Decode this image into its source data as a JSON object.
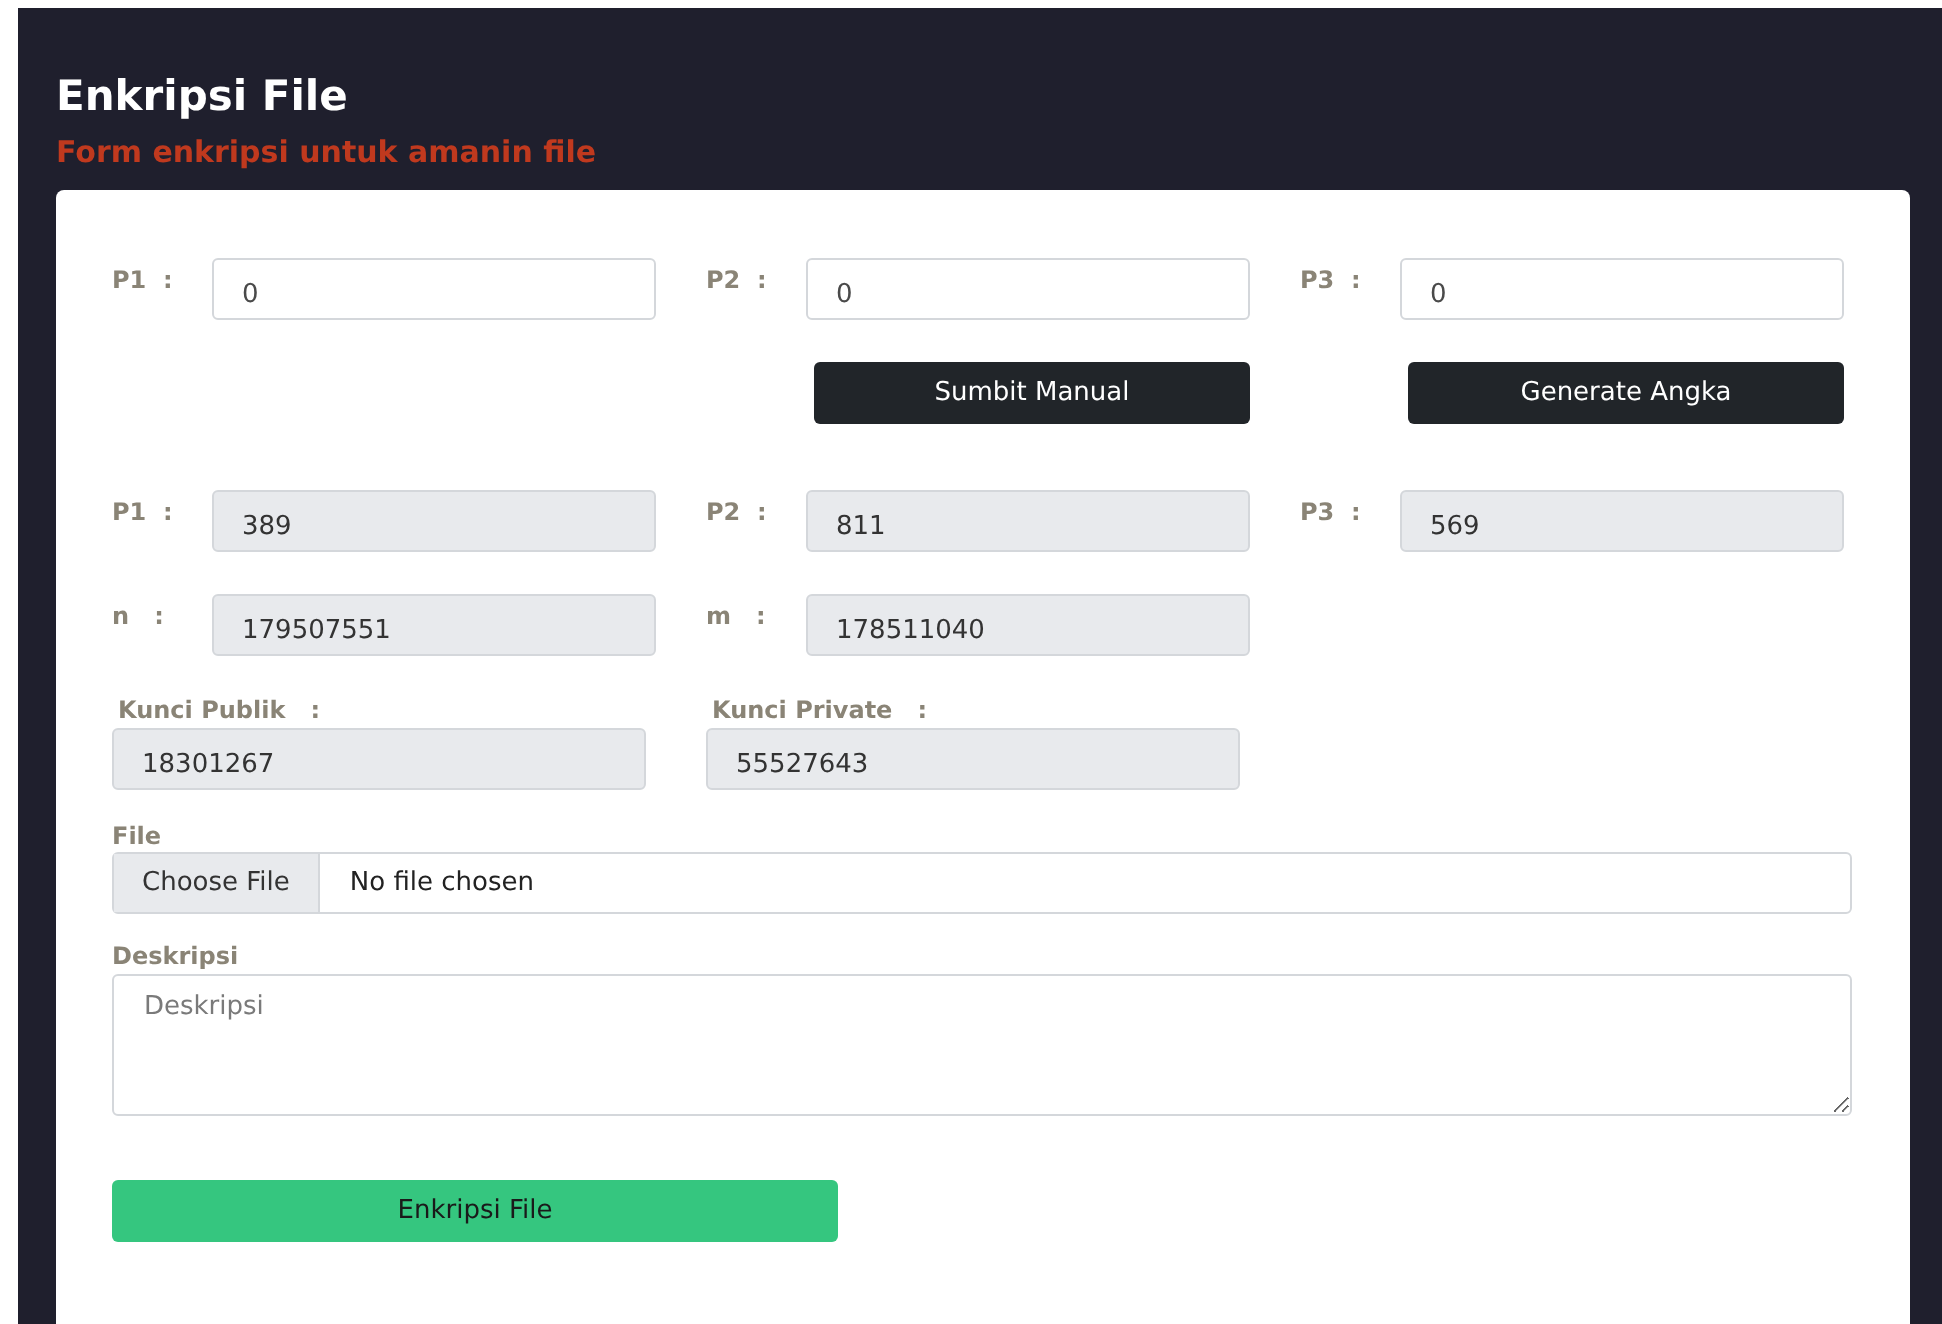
{
  "header": {
    "title": "Enkripsi File",
    "subtitle": "Form enkripsi untuk amanin file"
  },
  "manual_inputs": [
    {
      "label": "P1  :",
      "value": "0"
    },
    {
      "label": "P2  :",
      "value": "0"
    },
    {
      "label": "P3  :",
      "value": "0"
    }
  ],
  "actions": [
    {
      "label": "Sumbit Manual"
    },
    {
      "label": "Generate Angka"
    }
  ],
  "generated": [
    {
      "label": "P1  :",
      "value": "389"
    },
    {
      "label": "P2  :",
      "value": "811"
    },
    {
      "label": "P3  :",
      "value": "569"
    },
    {
      "label": "n   :",
      "value": "179507551"
    },
    {
      "label": "m   :",
      "value": "178511040"
    }
  ],
  "keys": [
    {
      "label": "Kunci Publik   :",
      "value": "18301267"
    },
    {
      "label": "Kunci Private   :",
      "value": "55527643"
    }
  ],
  "file": {
    "label": "File",
    "button": "Choose File",
    "status": "No file chosen"
  },
  "description": {
    "label": "Deskripsi",
    "placeholder": "Deskripsi"
  },
  "submit": {
    "label": "Enkripsi File"
  }
}
